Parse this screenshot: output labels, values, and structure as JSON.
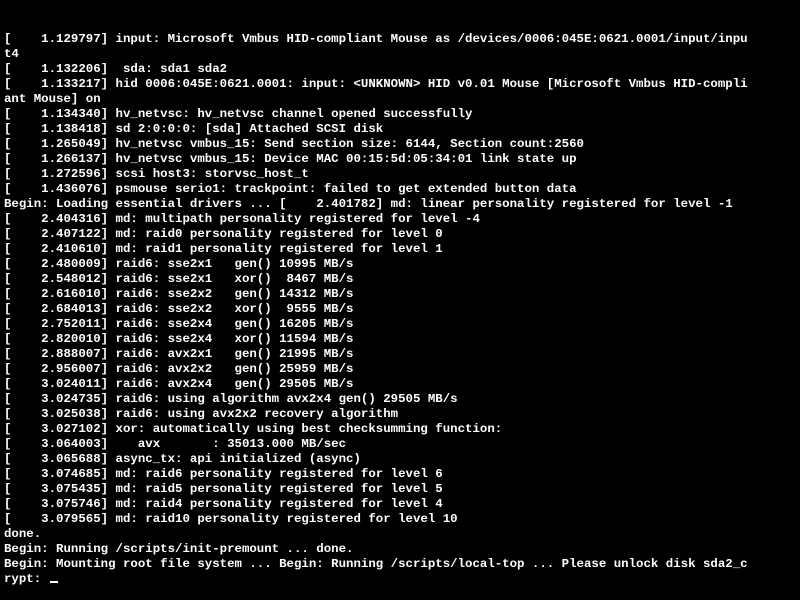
{
  "colors": {
    "bg": "#000000",
    "fg": "#ffffff"
  },
  "prompt_line": "rypt: ",
  "lines": [
    "[    1.129797] input: Microsoft Vmbus HID-compliant Mouse as /devices/0006:045E:0621.0001/input/inpu",
    "t4",
    "[    1.132206]  sda: sda1 sda2",
    "[    1.133217] hid 0006:045E:0621.0001: input: <UNKNOWN> HID v0.01 Mouse [Microsoft Vmbus HID-compli",
    "ant Mouse] on",
    "[    1.134340] hv_netvsc: hv_netvsc channel opened successfully",
    "[    1.138418] sd 2:0:0:0: [sda] Attached SCSI disk",
    "[    1.265049] hv_netvsc vmbus_15: Send section size: 6144, Section count:2560",
    "[    1.266137] hv_netvsc vmbus_15: Device MAC 00:15:5d:05:34:01 link state up",
    "[    1.272596] scsi host3: storvsc_host_t",
    "[    1.436076] psmouse serio1: trackpoint: failed to get extended button data",
    "Begin: Loading essential drivers ... [    2.401782] md: linear personality registered for level -1",
    "[    2.404316] md: multipath personality registered for level -4",
    "[    2.407122] md: raid0 personality registered for level 0",
    "[    2.410610] md: raid1 personality registered for level 1",
    "[    2.480009] raid6: sse2x1   gen() 10995 MB/s",
    "[    2.548012] raid6: sse2x1   xor()  8467 MB/s",
    "[    2.616010] raid6: sse2x2   gen() 14312 MB/s",
    "[    2.684013] raid6: sse2x2   xor()  9555 MB/s",
    "[    2.752011] raid6: sse2x4   gen() 16205 MB/s",
    "[    2.820010] raid6: sse2x4   xor() 11594 MB/s",
    "[    2.888007] raid6: avx2x1   gen() 21995 MB/s",
    "[    2.956007] raid6: avx2x2   gen() 25959 MB/s",
    "[    3.024011] raid6: avx2x4   gen() 29505 MB/s",
    "[    3.024735] raid6: using algorithm avx2x4 gen() 29505 MB/s",
    "[    3.025038] raid6: using avx2x2 recovery algorithm",
    "[    3.027102] xor: automatically using best checksumming function:",
    "[    3.064003]    avx       : 35013.000 MB/sec",
    "[    3.065688] async_tx: api initialized (async)",
    "[    3.074685] md: raid6 personality registered for level 6",
    "[    3.075435] md: raid5 personality registered for level 5",
    "[    3.075746] md: raid4 personality registered for level 4",
    "[    3.079565] md: raid10 personality registered for level 10",
    "done.",
    "Begin: Running /scripts/init-premount ... done.",
    "Begin: Mounting root file system ... Begin: Running /scripts/local-top ... Please unlock disk sda2_c"
  ]
}
